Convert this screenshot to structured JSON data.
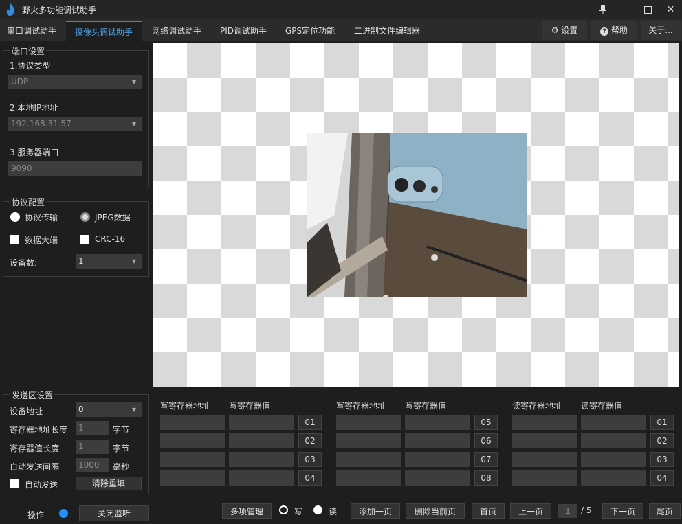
{
  "app": {
    "title": "野火多功能调试助手"
  },
  "tabs": [
    "串口调试助手",
    "摄像头调试助手",
    "网络调试助手",
    "PID调试助手",
    "GPS定位功能",
    "二进制文件编辑器"
  ],
  "right_buttons": {
    "settings": "设置",
    "help": "帮助",
    "about": "关于..."
  },
  "port": {
    "group_title": "端口设置",
    "protocol_label": "1.协议类型",
    "protocol_value": "UDP",
    "ip_label": "2.本地IP地址",
    "ip_value": "192.168.31.57",
    "server_port_label": "3.服务器端口",
    "server_port_value": "9090"
  },
  "protocol_config": {
    "group_title": "协议配置",
    "radio1": "协议传输",
    "radio2": "JPEG数据",
    "chk1": "数据大端",
    "chk2": "CRC-16",
    "device_count_label": "设备数:",
    "device_count_value": "1"
  },
  "send": {
    "group_title": "发送区设置",
    "device_addr_label": "设备地址",
    "device_addr_value": "0",
    "reg_addr_len_label": "寄存器地址长度",
    "reg_addr_len_value": "1",
    "reg_addr_len_unit": "字节",
    "reg_val_len_label": "寄存器值长度",
    "reg_val_len_value": "1",
    "reg_val_len_unit": "字节",
    "interval_label": "自动发送间隔",
    "interval_value": "1000",
    "interval_unit": "毫秒",
    "auto_send_label": "自动发送",
    "clear_button": "清除重填"
  },
  "operation": {
    "label": "操作",
    "close_monitor": "关闭监听"
  },
  "reg_columns": [
    {
      "addr_header": "写寄存器地址",
      "val_header": "写寄存器值",
      "nums": [
        "01",
        "02",
        "03",
        "04"
      ]
    },
    {
      "addr_header": "写寄存器地址",
      "val_header": "写寄存器值",
      "nums": [
        "05",
        "06",
        "07",
        "08"
      ]
    },
    {
      "addr_header": "读寄存器地址",
      "val_header": "读寄存器值",
      "nums": [
        "01",
        "02",
        "03",
        "04"
      ]
    }
  ],
  "bottom": {
    "multi_manage": "多项管理",
    "write": "写",
    "read": "读",
    "add_page": "添加一页",
    "delete_page": "删除当前页",
    "first": "首页",
    "prev": "上一页",
    "page_current": "1",
    "page_total": "/ 5",
    "next": "下一页",
    "last": "尾页"
  }
}
